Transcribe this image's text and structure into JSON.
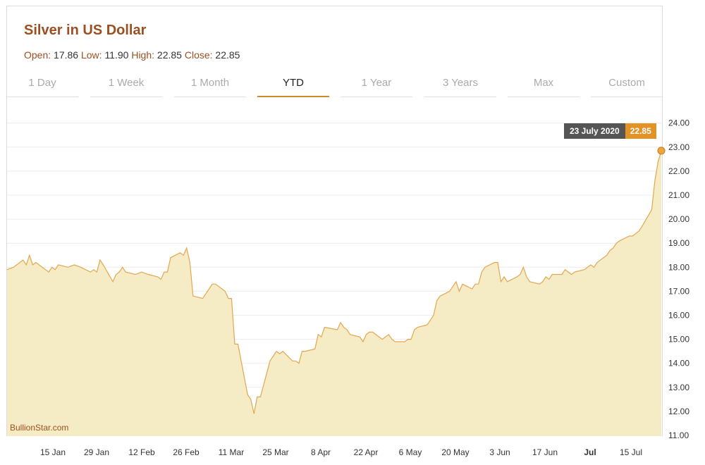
{
  "header": {
    "title": "Silver in US Dollar",
    "open_label": "Open:",
    "open_value": "17.86",
    "low_label": "Low:",
    "low_value": "11.90",
    "high_label": "High:",
    "high_value": "22.85",
    "close_label": "Close:",
    "close_value": "22.85"
  },
  "tabs": [
    {
      "label": "1 Day",
      "active": false
    },
    {
      "label": "1 Week",
      "active": false
    },
    {
      "label": "1 Month",
      "active": false
    },
    {
      "label": "YTD",
      "active": true
    },
    {
      "label": "1 Year",
      "active": false
    },
    {
      "label": "3 Years",
      "active": false
    },
    {
      "label": "Max",
      "active": false
    },
    {
      "label": "Custom",
      "active": false
    }
  ],
  "tooltip": {
    "date": "23 July 2020",
    "value": "22.85"
  },
  "watermark": "BullionStar.com",
  "colors": {
    "line": "#e3a650",
    "fill": "#f5ecc6",
    "accent": "#cf8a2e",
    "title": "#9c4f21"
  },
  "chart_data": {
    "type": "area",
    "ylim": [
      11,
      24
    ],
    "yticks": [
      "11.00",
      "12.00",
      "13.00",
      "14.00",
      "15.00",
      "16.00",
      "17.00",
      "18.00",
      "19.00",
      "20.00",
      "21.00",
      "22.00",
      "23.00",
      "24.00"
    ],
    "xticks": [
      "15 Jan",
      "29 Jan",
      "12 Feb",
      "26 Feb",
      "11 Mar",
      "25 Mar",
      "8 Apr",
      "22 Apr",
      "6 May",
      "20 May",
      "3 Jun",
      "17 Jun",
      "Jul",
      "15 Jul"
    ],
    "x_start": "2020-01-01",
    "x_end": "2020-07-23",
    "series": [
      {
        "values": [
          [
            "2020-01-01",
            17.9
          ],
          [
            "2020-01-03",
            18.0
          ],
          [
            "2020-01-06",
            18.3
          ],
          [
            "2020-01-07",
            18.1
          ],
          [
            "2020-01-08",
            18.5
          ],
          [
            "2020-01-09",
            18.1
          ],
          [
            "2020-01-10",
            18.2
          ],
          [
            "2020-01-13",
            17.9
          ],
          [
            "2020-01-14",
            17.8
          ],
          [
            "2020-01-15",
            18.0
          ],
          [
            "2020-01-16",
            17.9
          ],
          [
            "2020-01-17",
            18.1
          ],
          [
            "2020-01-20",
            18.0
          ],
          [
            "2020-01-22",
            18.1
          ],
          [
            "2020-01-24",
            18.0
          ],
          [
            "2020-01-27",
            17.8
          ],
          [
            "2020-01-28",
            17.9
          ],
          [
            "2020-01-29",
            17.8
          ],
          [
            "2020-01-30",
            18.3
          ],
          [
            "2020-01-31",
            18.1
          ],
          [
            "2020-02-03",
            17.4
          ],
          [
            "2020-02-04",
            17.7
          ],
          [
            "2020-02-05",
            17.8
          ],
          [
            "2020-02-06",
            18.0
          ],
          [
            "2020-02-07",
            17.8
          ],
          [
            "2020-02-10",
            17.7
          ],
          [
            "2020-02-12",
            17.8
          ],
          [
            "2020-02-14",
            17.7
          ],
          [
            "2020-02-17",
            17.6
          ],
          [
            "2020-02-18",
            17.5
          ],
          [
            "2020-02-19",
            17.8
          ],
          [
            "2020-02-20",
            17.8
          ],
          [
            "2020-02-21",
            18.4
          ],
          [
            "2020-02-24",
            18.6
          ],
          [
            "2020-02-25",
            18.5
          ],
          [
            "2020-02-26",
            18.8
          ],
          [
            "2020-02-27",
            18.2
          ],
          [
            "2020-02-28",
            16.8
          ],
          [
            "2020-03-02",
            16.7
          ],
          [
            "2020-03-03",
            16.9
          ],
          [
            "2020-03-04",
            17.1
          ],
          [
            "2020-03-05",
            17.3
          ],
          [
            "2020-03-06",
            17.3
          ],
          [
            "2020-03-09",
            17.0
          ],
          [
            "2020-03-10",
            16.7
          ],
          [
            "2020-03-11",
            16.7
          ],
          [
            "2020-03-12",
            14.8
          ],
          [
            "2020-03-13",
            14.8
          ],
          [
            "2020-03-16",
            12.7
          ],
          [
            "2020-03-17",
            12.5
          ],
          [
            "2020-03-18",
            11.9
          ],
          [
            "2020-03-19",
            12.6
          ],
          [
            "2020-03-20",
            12.6
          ],
          [
            "2020-03-23",
            14.1
          ],
          [
            "2020-03-24",
            14.3
          ],
          [
            "2020-03-25",
            14.5
          ],
          [
            "2020-03-26",
            14.4
          ],
          [
            "2020-03-27",
            14.5
          ],
          [
            "2020-03-30",
            14.1
          ],
          [
            "2020-03-31",
            14.1
          ],
          [
            "2020-04-01",
            14.0
          ],
          [
            "2020-04-02",
            14.5
          ],
          [
            "2020-04-03",
            14.5
          ],
          [
            "2020-04-06",
            14.6
          ],
          [
            "2020-04-07",
            15.2
          ],
          [
            "2020-04-08",
            15.1
          ],
          [
            "2020-04-09",
            15.5
          ],
          [
            "2020-04-13",
            15.4
          ],
          [
            "2020-04-14",
            15.7
          ],
          [
            "2020-04-15",
            15.5
          ],
          [
            "2020-04-16",
            15.4
          ],
          [
            "2020-04-17",
            15.2
          ],
          [
            "2020-04-20",
            15.1
          ],
          [
            "2020-04-21",
            14.9
          ],
          [
            "2020-04-22",
            15.2
          ],
          [
            "2020-04-23",
            15.3
          ],
          [
            "2020-04-24",
            15.3
          ],
          [
            "2020-04-27",
            15.0
          ],
          [
            "2020-04-28",
            15.1
          ],
          [
            "2020-04-29",
            15.2
          ],
          [
            "2020-04-30",
            15.0
          ],
          [
            "2020-05-01",
            14.9
          ],
          [
            "2020-05-04",
            14.9
          ],
          [
            "2020-05-05",
            15.0
          ],
          [
            "2020-05-06",
            15.0
          ],
          [
            "2020-05-07",
            15.4
          ],
          [
            "2020-05-08",
            15.5
          ],
          [
            "2020-05-11",
            15.6
          ],
          [
            "2020-05-12",
            15.8
          ],
          [
            "2020-05-13",
            16.0
          ],
          [
            "2020-05-14",
            16.6
          ],
          [
            "2020-05-15",
            16.8
          ],
          [
            "2020-05-18",
            17.0
          ],
          [
            "2020-05-19",
            17.2
          ],
          [
            "2020-05-20",
            17.4
          ],
          [
            "2020-05-21",
            17.0
          ],
          [
            "2020-05-22",
            17.3
          ],
          [
            "2020-05-25",
            17.1
          ],
          [
            "2020-05-26",
            17.3
          ],
          [
            "2020-05-27",
            17.3
          ],
          [
            "2020-05-28",
            17.8
          ],
          [
            "2020-05-29",
            18.0
          ],
          [
            "2020-06-01",
            18.2
          ],
          [
            "2020-06-02",
            18.2
          ],
          [
            "2020-06-03",
            17.4
          ],
          [
            "2020-06-04",
            17.6
          ],
          [
            "2020-06-05",
            17.4
          ],
          [
            "2020-06-08",
            17.6
          ],
          [
            "2020-06-09",
            17.7
          ],
          [
            "2020-06-10",
            18.0
          ],
          [
            "2020-06-11",
            17.6
          ],
          [
            "2020-06-12",
            17.4
          ],
          [
            "2020-06-15",
            17.3
          ],
          [
            "2020-06-16",
            17.4
          ],
          [
            "2020-06-17",
            17.6
          ],
          [
            "2020-06-18",
            17.5
          ],
          [
            "2020-06-19",
            17.7
          ],
          [
            "2020-06-22",
            17.7
          ],
          [
            "2020-06-23",
            17.9
          ],
          [
            "2020-06-24",
            17.8
          ],
          [
            "2020-06-25",
            17.7
          ],
          [
            "2020-06-26",
            17.8
          ],
          [
            "2020-06-29",
            17.9
          ],
          [
            "2020-06-30",
            18.0
          ],
          [
            "2020-07-01",
            18.1
          ],
          [
            "2020-07-02",
            18.0
          ],
          [
            "2020-07-03",
            18.2
          ],
          [
            "2020-07-06",
            18.5
          ],
          [
            "2020-07-07",
            18.7
          ],
          [
            "2020-07-08",
            18.8
          ],
          [
            "2020-07-09",
            19.0
          ],
          [
            "2020-07-10",
            19.1
          ],
          [
            "2020-07-13",
            19.3
          ],
          [
            "2020-07-14",
            19.3
          ],
          [
            "2020-07-15",
            19.4
          ],
          [
            "2020-07-16",
            19.5
          ],
          [
            "2020-07-17",
            19.7
          ],
          [
            "2020-07-20",
            20.4
          ],
          [
            "2020-07-21",
            21.6
          ],
          [
            "2020-07-22",
            22.4
          ],
          [
            "2020-07-23",
            22.85
          ]
        ]
      }
    ]
  }
}
